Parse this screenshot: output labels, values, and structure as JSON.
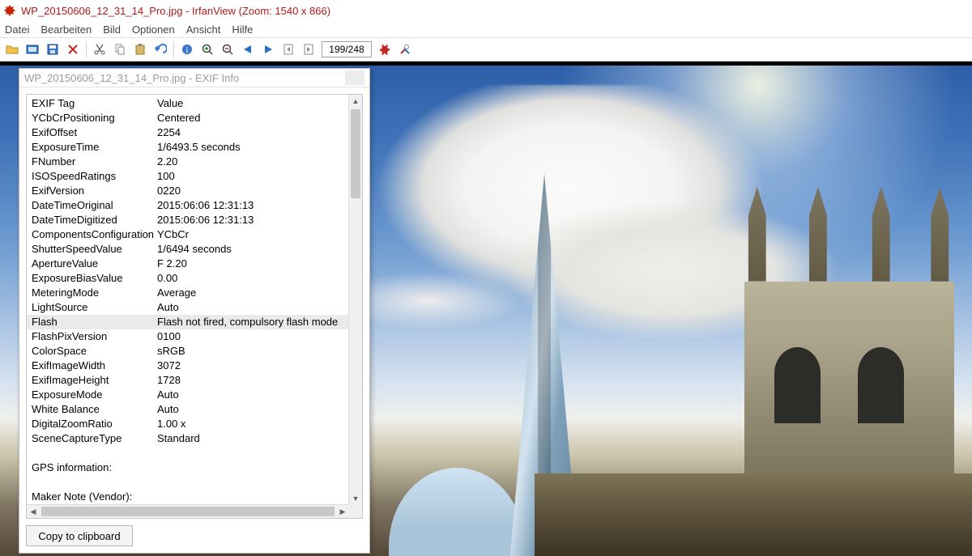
{
  "window": {
    "title": "WP_20150606_12_31_14_Pro.jpg - IrfanView (Zoom: 1540 x 866)"
  },
  "menu": [
    "Datei",
    "Bearbeiten",
    "Bild",
    "Optionen",
    "Ansicht",
    "Hilfe"
  ],
  "toolbar": {
    "page": "199/248"
  },
  "dialog": {
    "title": "WP_20150606_12_31_14_Pro.jpg - EXIF Info",
    "header": {
      "tag": "EXIF Tag",
      "value": "Value"
    },
    "selected_key": "Flash",
    "rows": [
      {
        "k": "YCbCrPositioning",
        "v": "Centered"
      },
      {
        "k": "ExifOffset",
        "v": "2254"
      },
      {
        "k": "ExposureTime",
        "v": "1/6493.5 seconds"
      },
      {
        "k": "FNumber",
        "v": "2.20"
      },
      {
        "k": "ISOSpeedRatings",
        "v": "100"
      },
      {
        "k": "ExifVersion",
        "v": "0220"
      },
      {
        "k": "DateTimeOriginal",
        "v": "2015:06:06 12:31:13"
      },
      {
        "k": "DateTimeDigitized",
        "v": "2015:06:06 12:31:13"
      },
      {
        "k": "ComponentsConfiguration",
        "v": "YCbCr"
      },
      {
        "k": "ShutterSpeedValue",
        "v": "1/6494 seconds"
      },
      {
        "k": "ApertureValue",
        "v": "F 2.20"
      },
      {
        "k": "ExposureBiasValue",
        "v": "0.00"
      },
      {
        "k": "MeteringMode",
        "v": "Average"
      },
      {
        "k": "LightSource",
        "v": "Auto"
      },
      {
        "k": "Flash",
        "v": "Flash not fired, compulsory flash mode"
      },
      {
        "k": "FlashPixVersion",
        "v": "0100"
      },
      {
        "k": "ColorSpace",
        "v": "sRGB"
      },
      {
        "k": "ExifImageWidth",
        "v": "3072"
      },
      {
        "k": "ExifImageHeight",
        "v": "1728"
      },
      {
        "k": "ExposureMode",
        "v": "Auto"
      },
      {
        "k": "White Balance",
        "v": "Auto"
      },
      {
        "k": "DigitalZoomRatio",
        "v": "1.00 x"
      },
      {
        "k": "SceneCaptureType",
        "v": "Standard"
      },
      {
        "k": "",
        "v": ""
      },
      {
        "k": "GPS information:",
        "v": ""
      },
      {
        "k": "",
        "v": ""
      },
      {
        "k": "Maker Note (Vendor):",
        "v": ""
      }
    ],
    "button": "Copy to clipboard"
  }
}
